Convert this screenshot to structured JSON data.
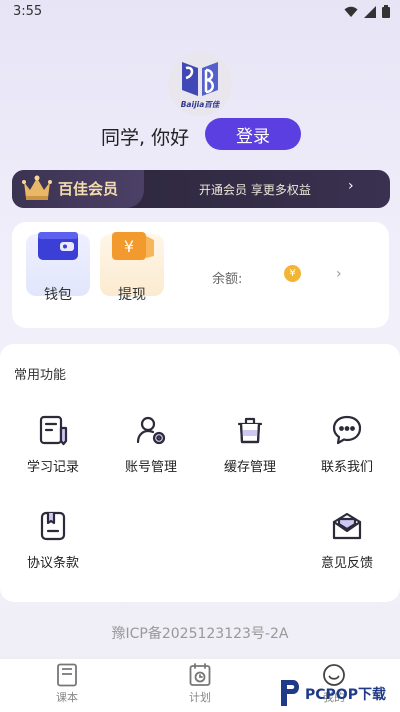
{
  "status": {
    "time": "3:55"
  },
  "profile": {
    "logo_text": "Baijia百佳",
    "greeting": "同学, 你好",
    "login_label": "登录"
  },
  "vip": {
    "title": "百佳会员",
    "promo": "开通会员 享更多权益",
    "arrow": "›"
  },
  "wallet": {
    "wallet_label": "钱包",
    "withdraw_label": "提现",
    "withdraw_symbol": "¥",
    "balance_label": "余额:",
    "balance_symbol": "¥",
    "arrow": "›"
  },
  "functions": {
    "title": "常用功能",
    "items": [
      {
        "label": "学习记录",
        "icon": "study-record-icon"
      },
      {
        "label": "账号管理",
        "icon": "account-settings-icon"
      },
      {
        "label": "缓存管理",
        "icon": "cache-bin-icon"
      },
      {
        "label": "联系我们",
        "icon": "chat-bubble-icon"
      },
      {
        "label": "协议条款",
        "icon": "agreement-icon"
      },
      {
        "label": "意见反馈",
        "icon": "feedback-mail-icon"
      }
    ]
  },
  "footer": {
    "icp": "豫ICP备2025123123号-2A"
  },
  "tabbar": {
    "items": [
      {
        "label": "课本"
      },
      {
        "label": "计划"
      },
      {
        "label": "我的"
      }
    ]
  },
  "watermark": {
    "text": "PCPOP下载"
  },
  "colors": {
    "accent": "#5b3fe0",
    "vip_gold": "#f3dcae",
    "vip_dark": "#2a2538"
  }
}
